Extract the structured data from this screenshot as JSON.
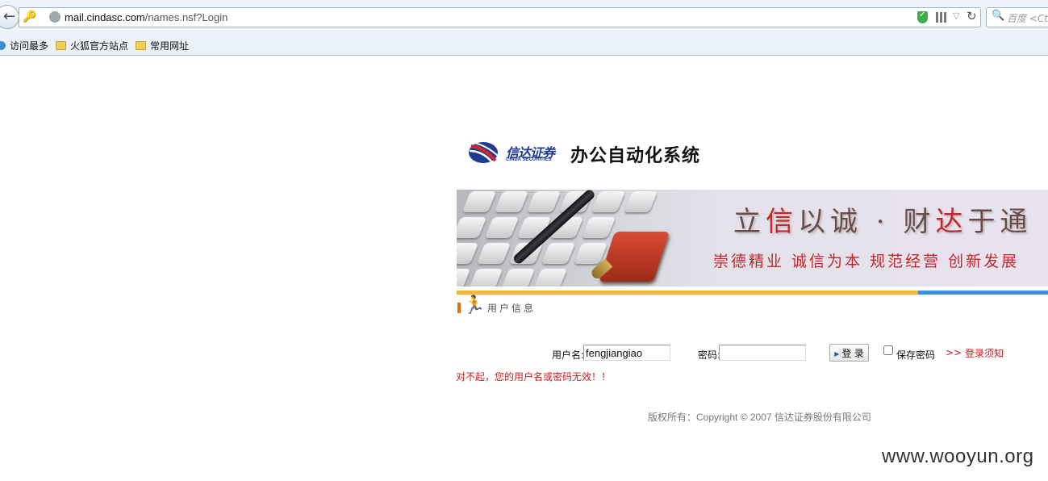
{
  "browser": {
    "url_domain": "mail.cindasc.com",
    "url_path": "/names.nsf?Login",
    "search_placeholder": "百度 <Ctrl+K>",
    "bookmarks": [
      {
        "label": "访问最多",
        "icon": "globe-icon"
      },
      {
        "label": "火狐官方站点",
        "icon": "folder-icon"
      },
      {
        "label": "常用网址",
        "icon": "folder-icon"
      }
    ]
  },
  "header": {
    "logo_cn": "信达证券",
    "logo_en": "CINDA SECURITIES",
    "system_title": "办公自动化系统"
  },
  "banner": {
    "slogan_1_parts": [
      "立",
      "信",
      "以诚",
      " · ",
      "财",
      "达",
      "于通"
    ],
    "slogan_2": "崇德精业 诚信为本 规范经营 创新发展"
  },
  "section": {
    "title": "用户信息"
  },
  "login_form": {
    "username_label": "用户名:",
    "username_value": "fengjiangiao",
    "password_label": "密码:",
    "password_value": "",
    "login_button": "登 录",
    "save_password_label": "保存密码",
    "save_password_checked": false,
    "notice_arrows": ">>",
    "notice_link": "登录须知",
    "error_message": "对不起，您的用户名或密码无效！！"
  },
  "footer": {
    "copyright": "版权所有：Copyright © 2007 信达证券股份有限公司"
  },
  "watermark": "www.wooyun.org",
  "colors": {
    "error_red": "#d21b1b",
    "brand_blue": "#1f3c8f",
    "bar_orange": "#f5b53a",
    "bar_blue": "#3c8fe3"
  }
}
